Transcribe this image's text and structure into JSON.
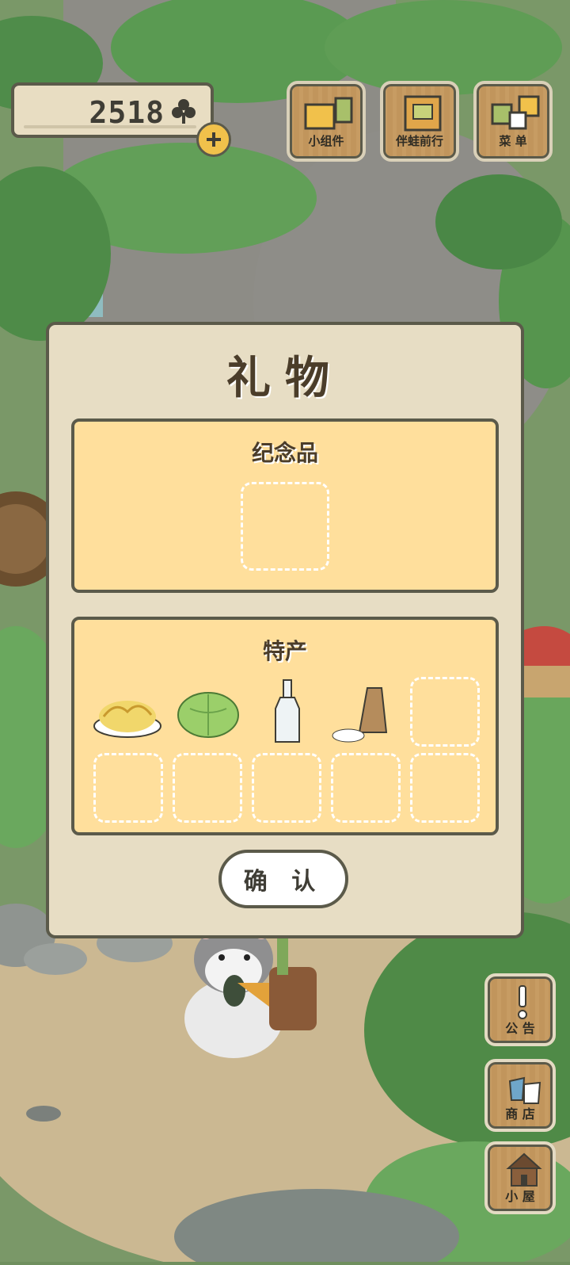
{
  "hud": {
    "clover_count": "2518",
    "buttons": [
      {
        "label": "小组件",
        "icon": "widget-icon"
      },
      {
        "label": "伴蛙前行",
        "icon": "journal-icon"
      },
      {
        "label": "菜 单",
        "icon": "menu-cards-icon"
      }
    ]
  },
  "side_buttons": [
    {
      "label": "公 告",
      "icon": "exclamation-icon"
    },
    {
      "label": "商 店",
      "icon": "shop-bags-icon"
    },
    {
      "label": "小 屋",
      "icon": "house-icon"
    }
  ],
  "dialog": {
    "title": "礼物",
    "souvenir": {
      "title": "纪念品",
      "slots": 1
    },
    "specialty": {
      "title": "特产",
      "items": [
        {
          "name": "fried-noodles-icon"
        },
        {
          "name": "cabbage-icon"
        },
        {
          "name": "glass-bottle-icon"
        },
        {
          "name": "rice-sack-icon"
        }
      ],
      "empty_slots": 6
    },
    "confirm_label": "确 认"
  },
  "colors": {
    "panel": "#ffdf9c",
    "dialog": "#e7ddc4",
    "outline": "#5b5a4a",
    "accent": "#f1c14b"
  }
}
